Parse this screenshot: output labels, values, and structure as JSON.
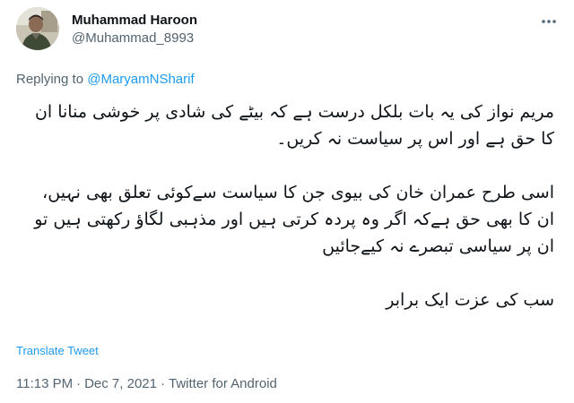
{
  "author": {
    "display_name": "Muhammad Haroon",
    "handle": "@Muhammad_8993",
    "avatar_icon": "profile-photo"
  },
  "reply": {
    "prefix": "Replying to ",
    "mention": "@MaryamNSharif"
  },
  "tweet": {
    "paragraphs": [
      "مریم نواز کی یہ بات بلکل درست ہے کہ بیٹے کی شادی پر خوشی منانا ان کا حق ہے اور اس پر سیاست نہ کریں۔",
      "اسی طرح عمران خان کی بیوی جن کا سیاست سےکوئی تعلق بھی نہیں، ان کا بھی حق ہےکہ اگر وہ پردہ کرتی ہیں اور مذہبی لگاؤ رکھتی ہیں تو ان پر سیاسی تبصرے نہ کیےجائیں",
      "سب کی عزت ایک برابر"
    ]
  },
  "translate_label": "Translate Tweet",
  "meta": {
    "time": "11:13 PM",
    "separator": "·",
    "date": "Dec 7, 2021",
    "source": "Twitter for Android"
  },
  "colors": {
    "link": "#1d9bf0",
    "secondary": "#536471",
    "text": "#0f1419"
  },
  "icons": {
    "more": "more-horizontal-icon"
  }
}
